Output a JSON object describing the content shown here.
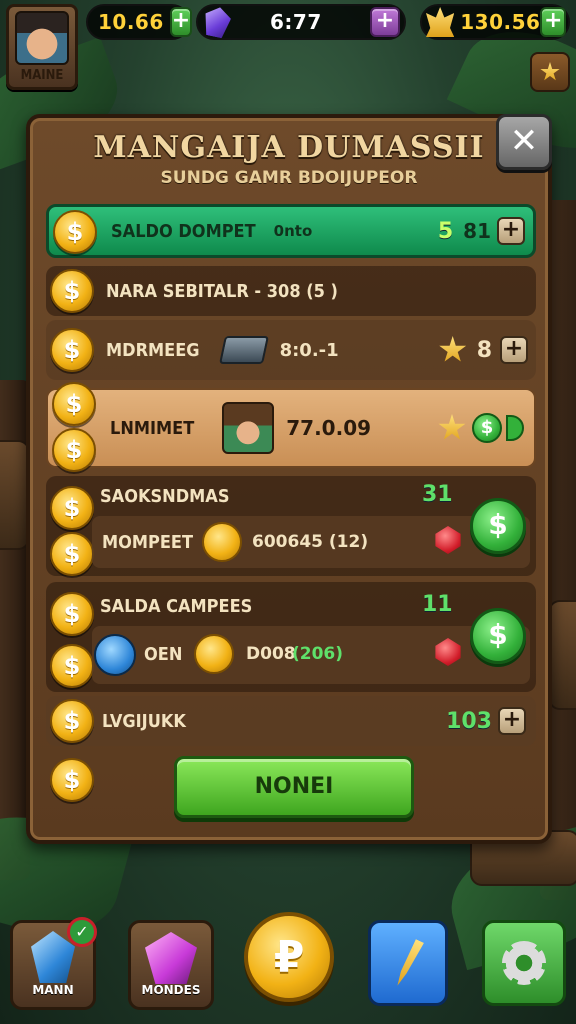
{
  "hud": {
    "player_name": "MAINE",
    "coins_top": "10.66",
    "timer": "6:77",
    "gold_balance": "130.56",
    "plus_symbol": "+"
  },
  "panel": {
    "title": "MANGAIJA DUMASSII",
    "subtitle": "SUNDG GAMR BDOIJUPEOR",
    "close_symbol": "✕"
  },
  "rows": [
    {
      "label": "SALDO DOMPET",
      "sub": "0nto",
      "count_a": "5",
      "count_b": "81"
    },
    {
      "label": "NARA SEBITALR - 308 (5 )"
    },
    {
      "label": "MDRMEEG",
      "value": "8:0.-1",
      "count": "8"
    },
    {
      "label": "LNMIMET",
      "value": "77.0.09"
    },
    {
      "label": "SAOKSNDMAS",
      "count": "31",
      "sub_label": "MOMPEET",
      "sub_value": "600645 (12)"
    },
    {
      "label": "SALDA CAMPEES",
      "count": "11",
      "sub_label": "OEN",
      "sub_value": "D008",
      "sub_value_green": "(206)"
    },
    {
      "label": "LVGIJUKK",
      "count": "103"
    }
  ],
  "coin_symbol": "$",
  "dollar_symbol": "$",
  "cta_label": "NONEI",
  "nav": {
    "item1_label": "MANN",
    "item2_label": "MONDES",
    "center_symbol": "₽"
  },
  "colors": {
    "accent_green": "#3fa61f",
    "panel_brown": "#6e4a2a",
    "gold": "#f2b215"
  }
}
